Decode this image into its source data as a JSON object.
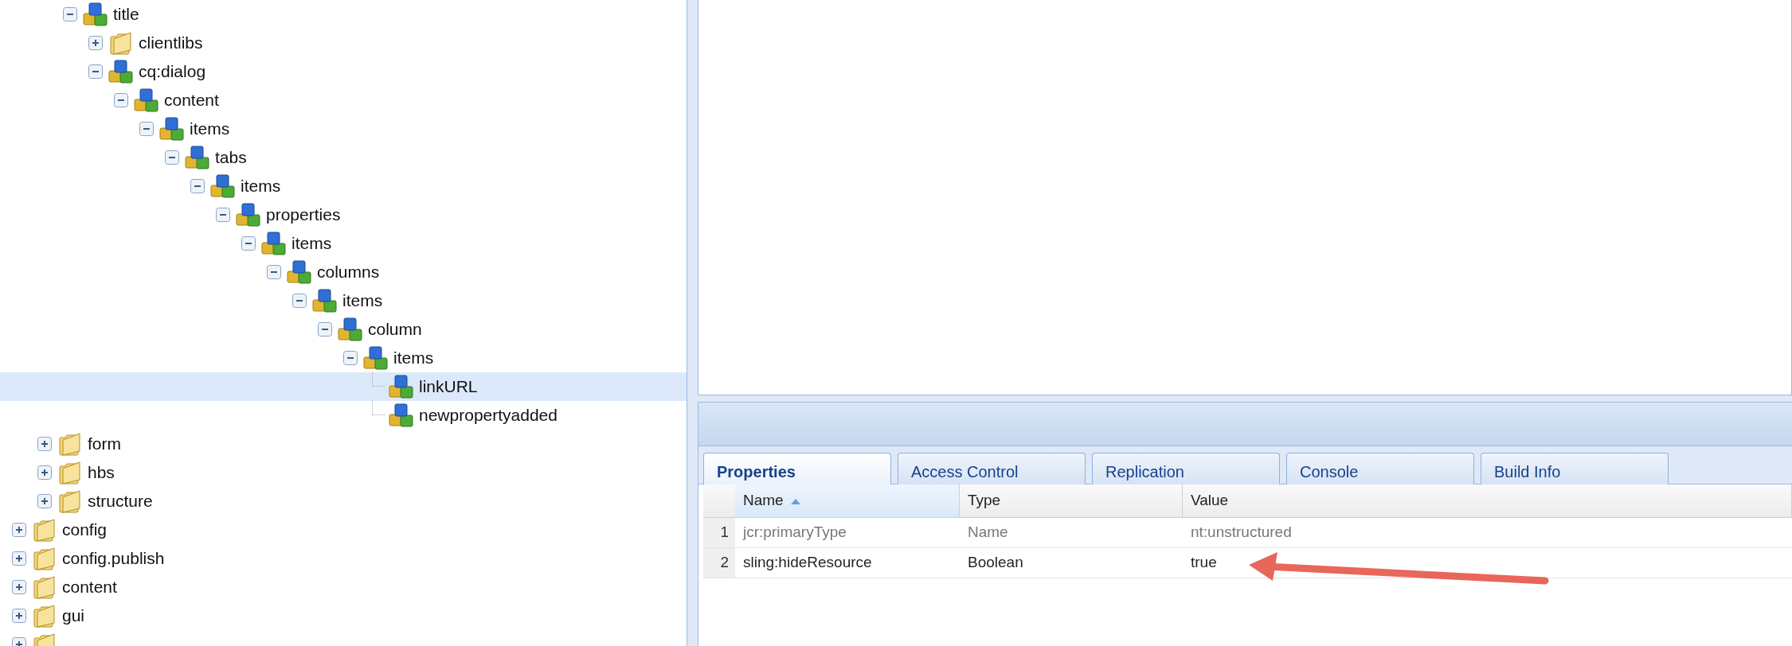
{
  "tree": [
    {
      "children": [
        {
          "children": [
            {
              "label": "title",
              "kind": "node",
              "expanded": true,
              "selected": false,
              "children": [
                {
                  "label": "clientlibs",
                  "kind": "folder",
                  "expanded": false,
                  "selected": false
                },
                {
                  "label": "cq:dialog",
                  "kind": "node",
                  "expanded": true,
                  "selected": false,
                  "children": [
                    {
                      "label": "content",
                      "kind": "node",
                      "expanded": true,
                      "selected": false,
                      "children": [
                        {
                          "label": "items",
                          "kind": "node",
                          "expanded": true,
                          "selected": false,
                          "children": [
                            {
                              "label": "tabs",
                              "kind": "node",
                              "expanded": true,
                              "selected": false,
                              "children": [
                                {
                                  "label": "items",
                                  "kind": "node",
                                  "expanded": true,
                                  "selected": false,
                                  "children": [
                                    {
                                      "label": "properties",
                                      "kind": "node",
                                      "expanded": true,
                                      "selected": false,
                                      "children": [
                                        {
                                          "label": "items",
                                          "kind": "node",
                                          "expanded": true,
                                          "selected": false,
                                          "children": [
                                            {
                                              "label": "columns",
                                              "kind": "node",
                                              "expanded": true,
                                              "selected": false,
                                              "children": [
                                                {
                                                  "label": "items",
                                                  "kind": "node",
                                                  "expanded": true,
                                                  "selected": false,
                                                  "children": [
                                                    {
                                                      "label": "column",
                                                      "kind": "node",
                                                      "expanded": true,
                                                      "selected": false,
                                                      "children": [
                                                        {
                                                          "label": "items",
                                                          "kind": "node",
                                                          "expanded": true,
                                                          "selected": false,
                                                          "children": [
                                                            {
                                                              "label": "linkURL",
                                                              "kind": "node",
                                                              "selected": true
                                                            },
                                                            {
                                                              "label": "newpropertyadded",
                                                              "kind": "node",
                                                              "selected": false
                                                            }
                                                          ]
                                                        }
                                                      ]
                                                    }
                                                  ]
                                                }
                                              ]
                                            }
                                          ]
                                        }
                                      ]
                                    }
                                  ]
                                }
                              ]
                            }
                          ]
                        }
                      ]
                    }
                  ]
                }
              ]
            }
          ]
        },
        {
          "label": "form",
          "kind": "folder",
          "expanded": false,
          "selected": false
        },
        {
          "label": "hbs",
          "kind": "folder",
          "expanded": false,
          "selected": false
        },
        {
          "label": "structure",
          "kind": "folder",
          "expanded": false,
          "selected": false
        }
      ]
    },
    {
      "label": "config",
      "kind": "folder",
      "expanded": false,
      "selected": false
    },
    {
      "label": "config.publish",
      "kind": "folder",
      "expanded": false,
      "selected": false
    },
    {
      "label": "content",
      "kind": "folder",
      "expanded": false,
      "selected": false
    },
    {
      "label": "gui",
      "kind": "folder",
      "expanded": false,
      "selected": false
    },
    {
      "kind": "folder",
      "expanded": false,
      "selected": false
    }
  ],
  "tabs": [
    {
      "label": "Properties",
      "selected": true
    },
    {
      "label": "Access Control",
      "selected": false
    },
    {
      "label": "Replication",
      "selected": false
    },
    {
      "label": "Console",
      "selected": false
    },
    {
      "label": "Build Info",
      "selected": false
    }
  ],
  "table": {
    "columns": [
      {
        "label": "Name",
        "sorted": true
      },
      {
        "label": "Type"
      },
      {
        "label": "Value"
      }
    ],
    "rows": [
      {
        "number": "1",
        "cells": [
          "jcr:primaryType",
          "Name",
          "nt:unstructured"
        ],
        "greyed": true
      },
      {
        "number": "2",
        "cells": [
          "sling:hideResource",
          "Boolean",
          "true"
        ],
        "greyed": false
      }
    ]
  }
}
